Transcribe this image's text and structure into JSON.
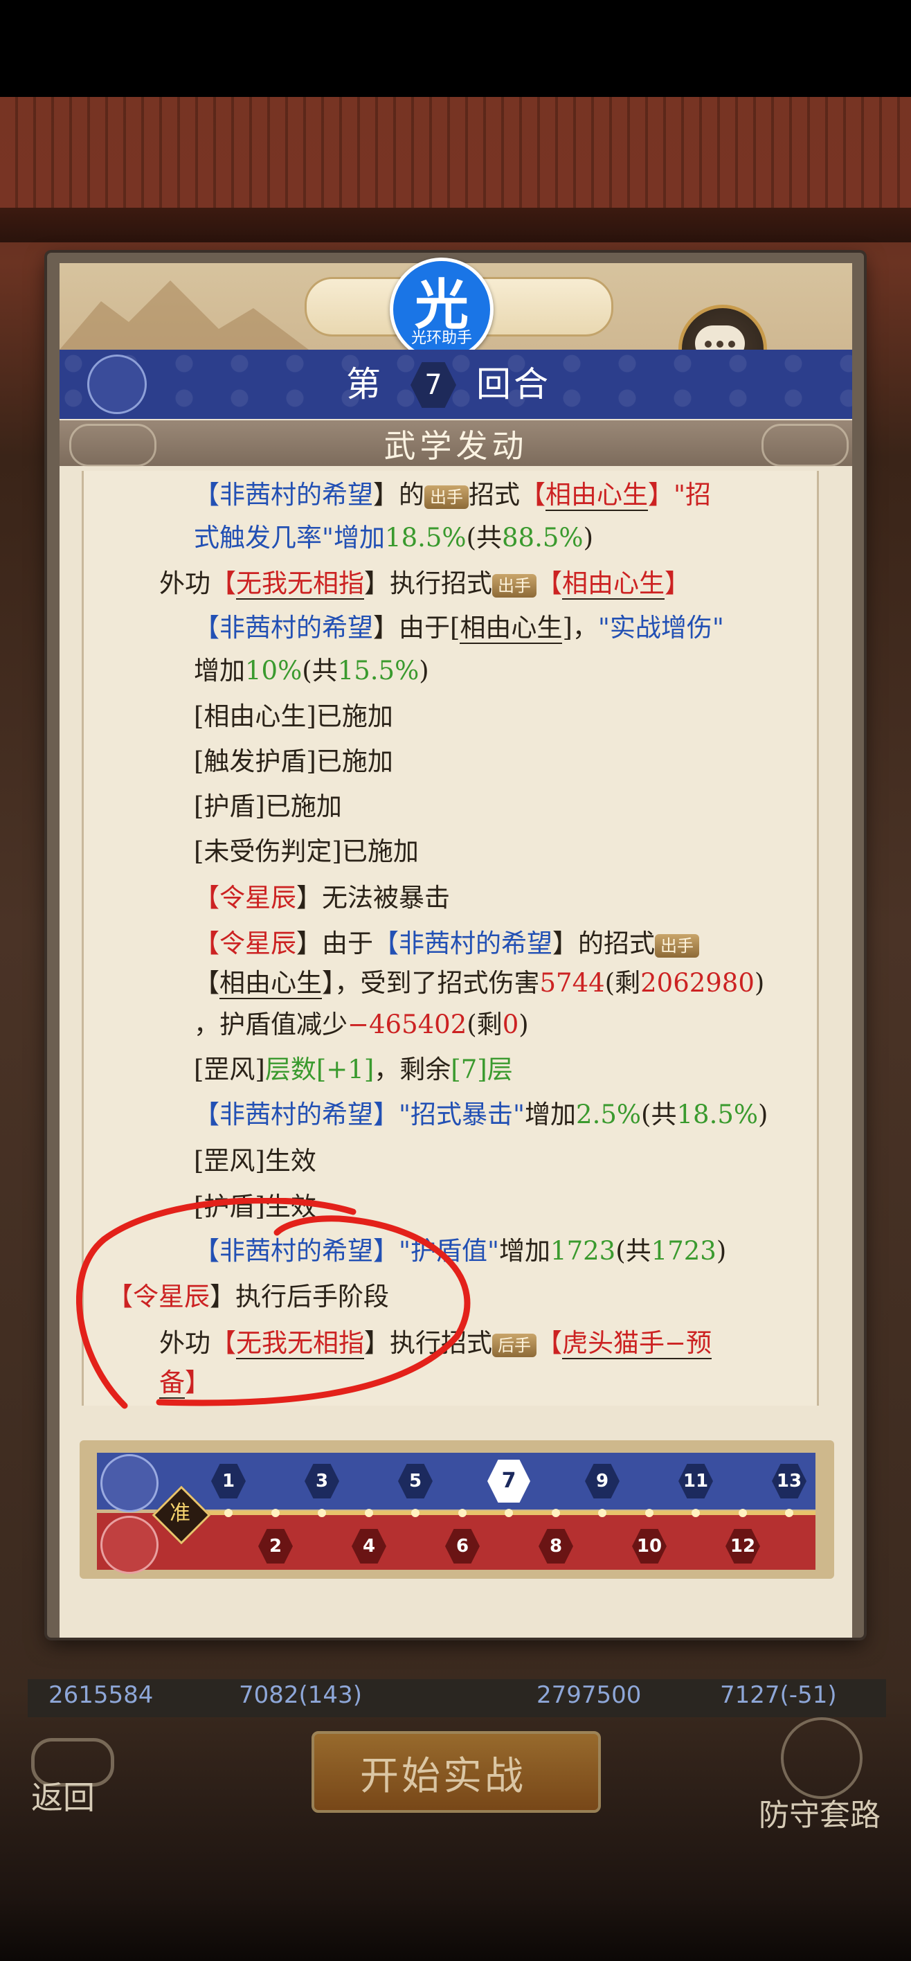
{
  "logo": {
    "char": "光",
    "name": "光环助手"
  },
  "round": {
    "prefix": "第",
    "number": "7",
    "suffix": "回合"
  },
  "section_title": "武学发动",
  "log": {
    "l1": {
      "a": "【",
      "name": "非茜村的希望",
      "b": "】的",
      "badge": "出手",
      "c": "招式",
      "d": "【",
      "skill": "相由心生",
      "e": "】\"招"
    },
    "l2": {
      "a": "式触发几率\"增加",
      "v1": "18.5%",
      "b": "(共",
      "v2": "88.5%",
      "c": ")"
    },
    "l3": {
      "a": "外功",
      "b": "【",
      "skill": "无我无相指",
      "c": "】执行招式",
      "badge": "出手",
      "d": "【",
      "skill2": "相由心生",
      "e": "】"
    },
    "l4": {
      "a": "【",
      "name": "非茜村的希望",
      "b": "】由于[",
      "skill": "相由心生",
      "c": "]，",
      "d": "\"实战增伤\""
    },
    "l5": {
      "a": "增加",
      "v1": "10%",
      "b": "(共",
      "v2": "15.5%",
      "c": ")"
    },
    "l6": "[相由心生]已施加",
    "l7": "[触发护盾]已施加",
    "l8": "[护盾]已施加",
    "l9": "[未受伤判定]已施加",
    "l10": {
      "a": "【",
      "name": "令星辰",
      "b": "】无法被暴击"
    },
    "l11": {
      "a": "【",
      "name": "令星辰",
      "b": "】由于",
      "c": "【",
      "name2": "非茜村的希望",
      "d": "】的招式",
      "badge": "出手"
    },
    "l12": {
      "a": "【",
      "skill": "相由心生",
      "b": "】，受到了招式伤害",
      "v1": "5744",
      "c": "(剩",
      "v2": "2062980",
      "d": ")"
    },
    "l13": {
      "a": "，护盾值减少",
      "v1": "−465402",
      "b": "(剩",
      "v2": "0",
      "c": ")"
    },
    "l14": {
      "a": "[罡风]",
      "b": "层数[+1]",
      "c": "，剩余",
      "d": "[7]层"
    },
    "l15": {
      "a": "【",
      "name": "非茜村的希望",
      "b": "】",
      "c": "\"招式暴击\"",
      "d": "增加",
      "v1": "2.5%",
      "e": "(共",
      "v2": "18.5%",
      "f": ")"
    },
    "l16": "[罡风]生效",
    "l17": "[护盾]生效",
    "l18": {
      "a": "【",
      "name": "非茜村的希望",
      "b": "】",
      "c": "\"护盾值\"",
      "d": "增加",
      "v1": "1723",
      "e": "(共",
      "v2": "1723",
      "f": ")"
    },
    "l19": {
      "a": "【",
      "name": "令星辰",
      "b": "】执行后手阶段"
    },
    "l20": {
      "a": "外功",
      "b": "【",
      "skill": "无我无相指",
      "c": "】执行招式",
      "badge": "后手",
      "d": "【",
      "skill2": "虎头猫手−预"
    },
    "l21": {
      "a": "备",
      "b": "】"
    }
  },
  "timeline": {
    "ready": "准",
    "top": [
      "1",
      "3",
      "5",
      "7",
      "9",
      "11",
      "13"
    ],
    "bottom": [
      "2",
      "4",
      "6",
      "8",
      "10",
      "12"
    ],
    "current": "7"
  },
  "stats": {
    "left_power": "2615584",
    "left_def": "7082(143)",
    "right_power": "2797500",
    "right_def": "7127(-51)"
  },
  "buttons": {
    "back": "返回",
    "start": "开始实战",
    "defense": "防守套路"
  },
  "colors": {
    "name_blue": "#2250b4",
    "name_red": "#cc2222",
    "value_green": "#3a9a2e",
    "round_bar": "#2c3e8c"
  }
}
